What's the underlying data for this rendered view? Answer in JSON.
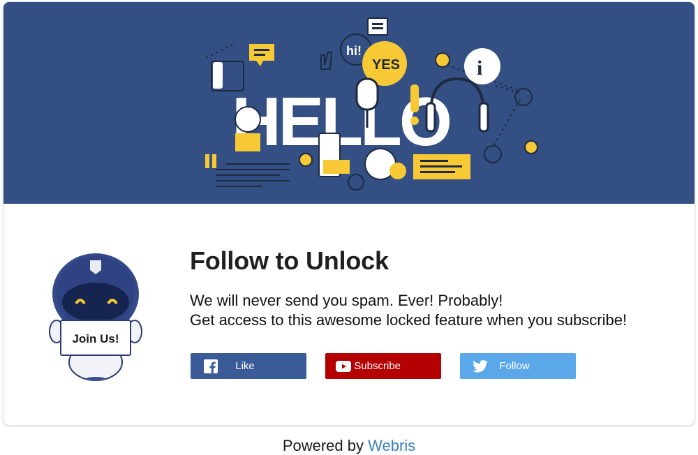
{
  "banner": {
    "hello_text": "HELLO",
    "yes_text": "YES",
    "hi_text": "hi!"
  },
  "mascot": {
    "sign_text": "Join Us!"
  },
  "content": {
    "title": "Follow to Unlock",
    "description_lines": [
      "We will never send you spam. Ever! Probably!",
      "Get access to this awesome locked feature when you subscribe!"
    ]
  },
  "buttons": {
    "like": {
      "label": "Like",
      "icon": "facebook-icon",
      "color": "#3b5a98"
    },
    "subscribe": {
      "label": "Subscribe",
      "icon": "youtube-icon",
      "color": "#b50000"
    },
    "follow": {
      "label": "Follow",
      "icon": "twitter-icon",
      "color": "#5aa7e9"
    }
  },
  "footer": {
    "powered_by": "Powered by",
    "brand": "Webris"
  },
  "colors": {
    "banner_bg": "#334f83",
    "accent_yellow": "#f7c934",
    "link": "#3b7fc4"
  }
}
